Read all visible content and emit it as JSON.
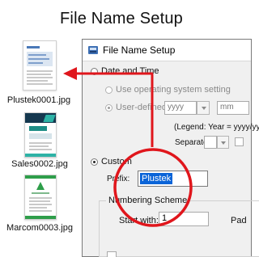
{
  "heading": "File Name Setup",
  "thumbnails": [
    {
      "caption": "Plustek0001.jpg"
    },
    {
      "caption": "Sales0002.jpg"
    },
    {
      "caption": "Marcom0003.jpg"
    }
  ],
  "dialog": {
    "title": "File Name Setup",
    "date_time": {
      "label": "Date and Time",
      "use_os": "Use operating system setting",
      "user_defined": "User-defined",
      "year_format": "yyyy",
      "month_format": "mm",
      "legend": "(Legend: Year = yyyy/yy",
      "separator_label": "Separator:"
    },
    "custom": {
      "label": "Custom",
      "prefix_label": "Prefix:",
      "prefix_value": "Plustek",
      "numbering": {
        "group_label": "Numbering Scheme",
        "start_label": "Start with:",
        "start_value": "1",
        "pad_label": "Pad"
      }
    }
  },
  "colors": {
    "annotation_red": "#e0161c",
    "selection_blue": "#0a64d8"
  }
}
